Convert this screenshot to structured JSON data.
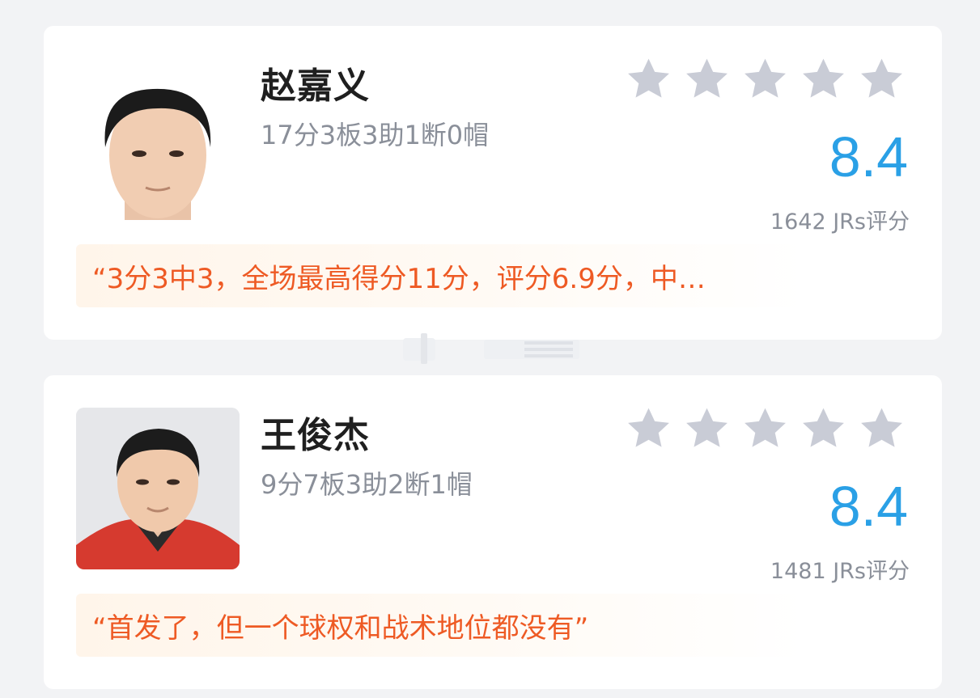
{
  "players": [
    {
      "name": "赵嘉义",
      "stats": "17分3板3助1断0帽",
      "rating_stars": 0,
      "score": "8.4",
      "jrs_rating": "1642 JRs评分",
      "quote": "“3分3中3，全场最高得分11分，评分6.9分，中…"
    },
    {
      "name": "王俊杰",
      "stats": "9分7板3助2断1帽",
      "rating_stars": 0,
      "score": "8.4",
      "jrs_rating": "1481 JRs评分",
      "quote": "“首发了，但一个球权和战术地位都没有”"
    }
  ],
  "colors": {
    "score": "#2aa0e6",
    "quote_text": "#ee5a24",
    "star_empty": "#c9ccd6",
    "stats_text": "#8a8f99"
  }
}
